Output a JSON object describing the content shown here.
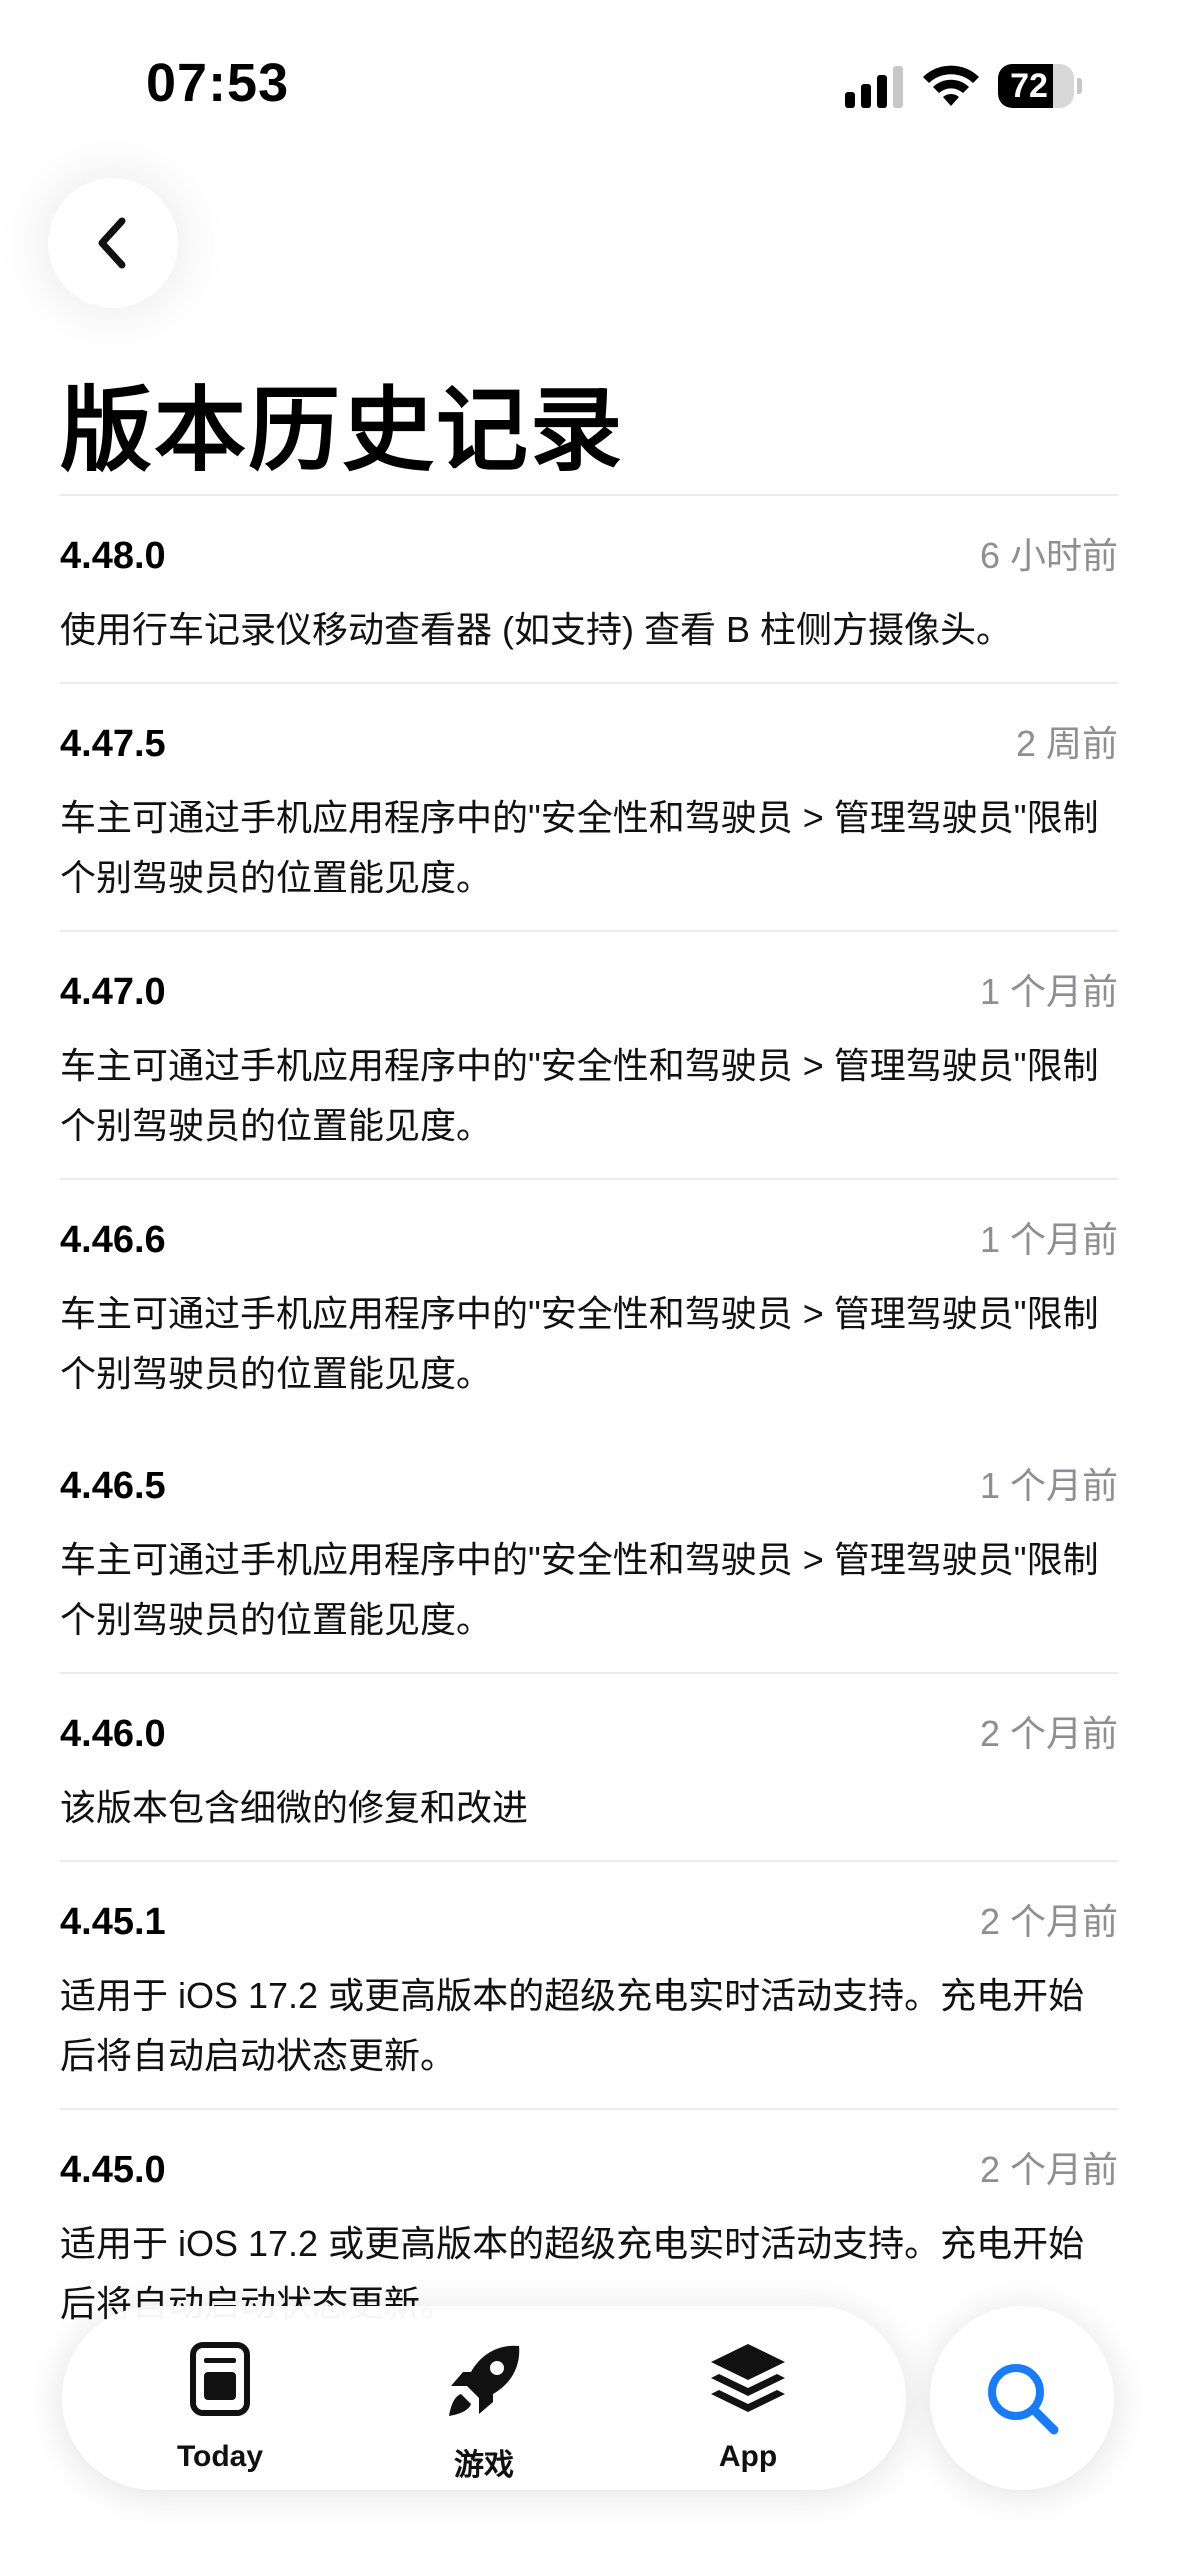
{
  "status_bar": {
    "time": "07:53",
    "battery_level": "72",
    "battery_fraction": 0.72
  },
  "header": {
    "back_icon": "chevron-left-icon",
    "title": "版本历史记录"
  },
  "versions": [
    {
      "number": "4.48.0",
      "time": "6 小时前",
      "notes": "使用行车记录仪移动查看器 (如支持) 查看 B 柱侧方摄像头。"
    },
    {
      "number": "4.47.5",
      "time": "2 周前",
      "notes": "车主可通过手机应用程序中的\"安全性和驾驶员 > 管理驾驶员\"限制个别驾驶员的位置能见度。"
    },
    {
      "number": "4.47.0",
      "time": "1 个月前",
      "notes": "车主可通过手机应用程序中的\"安全性和驾驶员 > 管理驾驶员\"限制个别驾驶员的位置能见度。"
    },
    {
      "number": "4.46.6",
      "time": "1 个月前",
      "notes": "车主可通过手机应用程序中的\"安全性和驾驶员 > 管理驾驶员\"限制个别驾驶员的位置能见度。"
    },
    {
      "number": "4.46.5",
      "time": "1 个月前",
      "notes": "车主可通过手机应用程序中的\"安全性和驾驶员 > 管理驾驶员\"限制个别驾驶员的位置能见度。"
    },
    {
      "number": "4.46.0",
      "time": "2 个月前",
      "notes": "该版本包含细微的修复和改进"
    },
    {
      "number": "4.45.1",
      "time": "2 个月前",
      "notes": "适用于 iOS 17.2 或更高版本的超级充电实时活动支持。充电开始后将自动启动状态更新。"
    },
    {
      "number": "4.45.0",
      "time": "2 个月前",
      "notes": "适用于 iOS 17.2 或更高版本的超级充电实时活动支持。充电开始后将自动启动状态更新。"
    }
  ],
  "tab_bar": {
    "tabs": [
      {
        "label": "Today",
        "icon": "today-icon"
      },
      {
        "label": "游戏",
        "icon": "rocket-icon"
      },
      {
        "label": "App",
        "icon": "app-stack-icon"
      }
    ],
    "search_icon": "search-icon",
    "accent_color": "#1a7cf5"
  }
}
